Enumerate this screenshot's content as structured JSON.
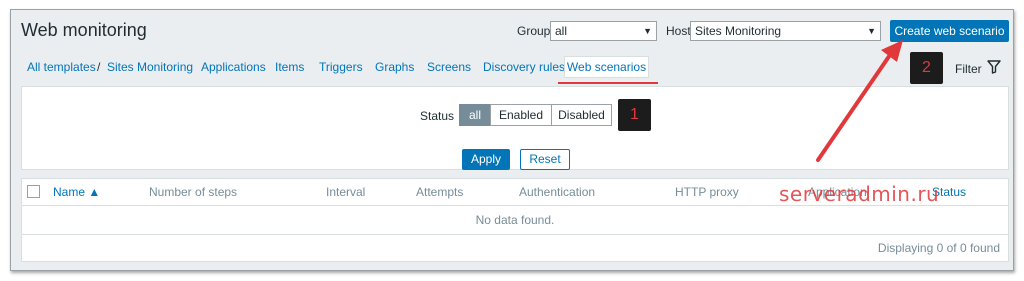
{
  "header": {
    "title": "Web monitoring",
    "group_label": "Group",
    "group_value": "all",
    "host_label": "Host",
    "host_value": "Sites Monitoring",
    "create_button": "Create web scenario"
  },
  "nav": {
    "items": [
      "All templates",
      "/",
      "Sites Monitoring",
      "Applications",
      "Items",
      "Triggers",
      "Graphs",
      "Screens",
      "Discovery rules"
    ],
    "active_tab": "Web scenarios"
  },
  "filter": {
    "label": "Filter",
    "status_label": "Status",
    "status_options": [
      "all",
      "Enabled",
      "Disabled"
    ],
    "selected": "all",
    "apply": "Apply",
    "reset": "Reset"
  },
  "table": {
    "columns": [
      "Name ▲",
      "Number of steps",
      "Interval",
      "Attempts",
      "Authentication",
      "HTTP proxy",
      "Application",
      "Status"
    ],
    "empty": "No data found.",
    "footer": "Displaying 0 of 0 found"
  },
  "annotations": {
    "badge_1": "1",
    "badge_2": "2",
    "watermark": "serveradmin.ru",
    "accent": "#e0383b"
  },
  "colors": {
    "primary": "#0275b8",
    "muted": "#768d99",
    "background": "#ebeef0"
  }
}
